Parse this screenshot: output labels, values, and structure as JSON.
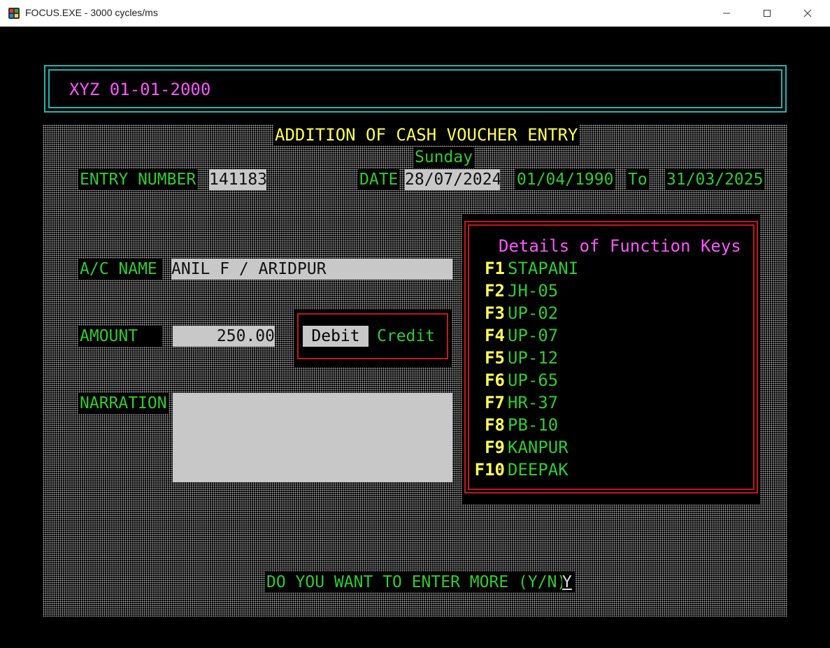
{
  "window": {
    "title": "FOCUS.EXE - 3000 cycles/ms",
    "minimize_glyph": "—",
    "maximize_glyph": "☐",
    "close_glyph": "✕"
  },
  "header": {
    "text": "XYZ 01-01-2000"
  },
  "form": {
    "title": "ADDITION OF CASH VOUCHER ENTRY",
    "day": "Sunday",
    "entry_number_label": "ENTRY NUMBER",
    "entry_number_value": "141183",
    "date_label": "DATE",
    "date_value": "28/07/2024",
    "period_from": "01/04/1990",
    "period_to_label": "To",
    "period_to": "31/03/2025",
    "ac_name_label": "A/C NAME",
    "ac_name_value": "ANIL F / ARIDPUR",
    "amount_label": "AMOUNT",
    "amount_value": "250.00",
    "debit_label": "Debit",
    "credit_label": "Credit",
    "narration_label": "NARRATION",
    "narration_value": "",
    "prompt": "DO YOU WANT TO ENTER MORE (Y/N)",
    "prompt_answer": "Y"
  },
  "function_keys": {
    "title": "Details of Function Keys",
    "items": [
      {
        "key": "F1",
        "value": "STAPANI"
      },
      {
        "key": "F2",
        "value": "JH-05"
      },
      {
        "key": "F3",
        "value": "UP-02"
      },
      {
        "key": "F4",
        "value": "UP-07"
      },
      {
        "key": "F5",
        "value": "UP-12"
      },
      {
        "key": "F6",
        "value": "UP-65"
      },
      {
        "key": "F7",
        "value": "HR-37"
      },
      {
        "key": "F8",
        "value": "PB-10"
      },
      {
        "key": "F9",
        "value": "KANPUR"
      },
      {
        "key": "F10",
        "value": "DEEPAK"
      }
    ]
  },
  "colors": {
    "label_green": "#2ecc2e",
    "title_yellow": "#ffff55",
    "magenta": "#ff55ff",
    "cyan_border": "#1fb5b5",
    "red_border": "#c41818",
    "field_gray": "#c8c8c8"
  }
}
